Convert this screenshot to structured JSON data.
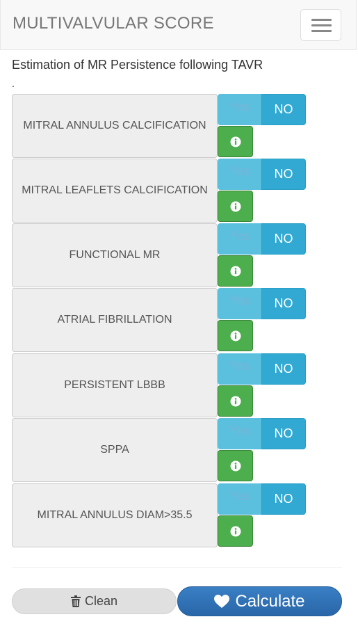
{
  "header": {
    "title": "MULTIVALVULAR SCORE",
    "menu_icon": "hamburger-icon"
  },
  "subtitle": "Estimation of MR Persistence following TAVR",
  "dot": ".",
  "toggle_labels": {
    "yes": "Yes",
    "no": "NO"
  },
  "info_icon": "info-icon",
  "criteria": [
    {
      "label": "MITRAL ANNULUS CALCIFICATION",
      "selected": "NO"
    },
    {
      "label": "MITRAL LEAFLETS CALCIFICATION",
      "selected": "NO"
    },
    {
      "label": "FUNCTIONAL MR",
      "selected": "NO"
    },
    {
      "label": "ATRIAL FIBRILLATION",
      "selected": "NO"
    },
    {
      "label": "PERSISTENT LBBB",
      "selected": "NO"
    },
    {
      "label": "SPPA",
      "selected": "NO"
    },
    {
      "label": "MITRAL ANNULUS DIAM>35.5",
      "selected": "NO"
    }
  ],
  "footer": {
    "clean_label": "Clean",
    "clean_icon": "trash-icon",
    "calculate_label": "Calculate",
    "calculate_icon": "heart-icon"
  },
  "colors": {
    "yes_bg": "#5bc0de",
    "no_bg": "#31a9d3",
    "info_bg": "#4cae4c",
    "calculate_bg": "#2f72b8"
  }
}
